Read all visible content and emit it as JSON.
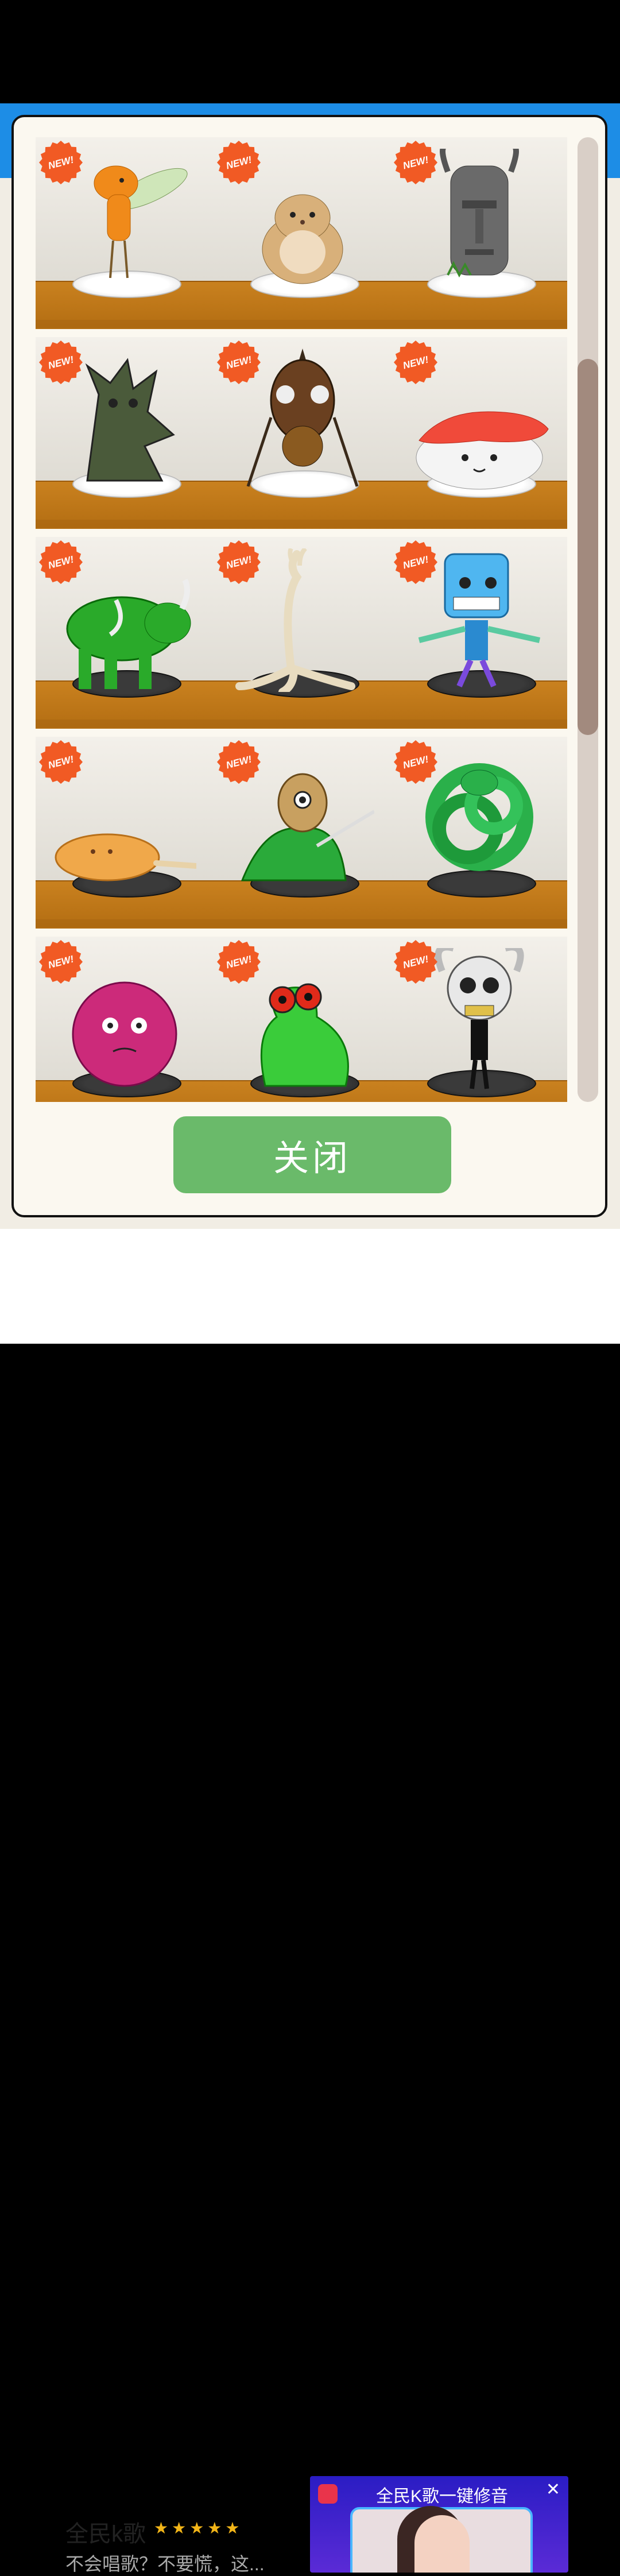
{
  "badge_text": "NEW!",
  "close_button_label": "关闭",
  "ad": {
    "app_name": "全民k歌",
    "stars": "★★★★★",
    "description": "不会唱歌？不要慌，这...",
    "banner_title": "全民K歌一键修音"
  },
  "colors": {
    "shelf_wood": "#c07a1a",
    "close_button": "#6aba6a",
    "badge": "#f15a24",
    "top_band": "#1d8de6"
  },
  "scrollbar": {
    "position_fraction": 0.23,
    "visible_fraction": 0.39
  },
  "shelves": [
    {
      "items": [
        {
          "name": "orange-winged-creature",
          "base": "white"
        },
        {
          "name": "hamster",
          "base": "white"
        },
        {
          "name": "moai-statue",
          "base": "white"
        }
      ]
    },
    {
      "items": [
        {
          "name": "tree-creature",
          "base": "white"
        },
        {
          "name": "beetle-creature",
          "base": "white"
        },
        {
          "name": "sushi-creature",
          "base": "white"
        }
      ]
    },
    {
      "items": [
        {
          "name": "green-rhino",
          "base": "black"
        },
        {
          "name": "root-hand",
          "base": "black"
        },
        {
          "name": "blue-robot",
          "base": "black"
        }
      ]
    },
    {
      "items": [
        {
          "name": "corn-dog",
          "base": "black"
        },
        {
          "name": "masked-goblin",
          "base": "black"
        },
        {
          "name": "green-snake-knot",
          "base": "black"
        }
      ]
    },
    {
      "items": [
        {
          "name": "pink-blob",
          "base": "black"
        },
        {
          "name": "green-frog",
          "base": "black"
        },
        {
          "name": "horned-skull-figure",
          "base": "black"
        }
      ]
    }
  ]
}
